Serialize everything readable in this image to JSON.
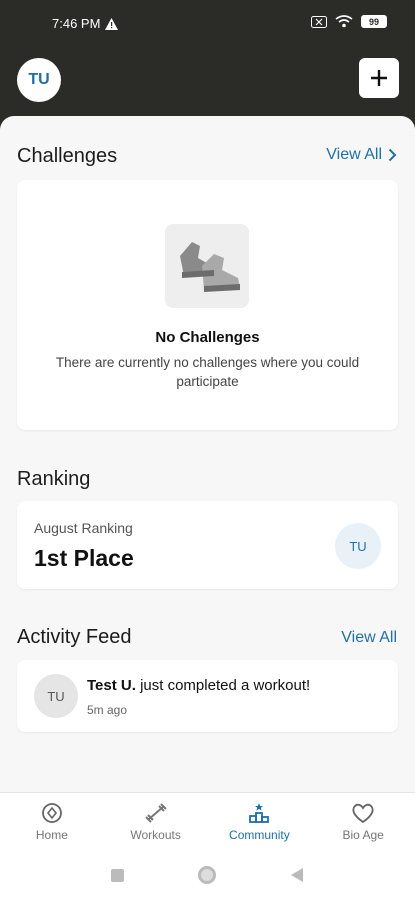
{
  "status": {
    "time": "7:46 PM",
    "battery": "99"
  },
  "header": {
    "avatar_initials": "TU"
  },
  "challenges": {
    "title": "Challenges",
    "view_all": "View All",
    "empty_title": "No Challenges",
    "empty_desc": "There are currently no challenges where you could participate"
  },
  "ranking": {
    "title": "Ranking",
    "label": "August Ranking",
    "value": "1st Place",
    "avatar_initials": "TU"
  },
  "feed": {
    "title": "Activity Feed",
    "view_all": "View All",
    "items": [
      {
        "avatar_initials": "TU",
        "user": "Test U.",
        "action": " just completed a workout!",
        "time": "5m ago"
      }
    ]
  },
  "nav": {
    "items": [
      {
        "label": "Home",
        "icon": "home-target-icon"
      },
      {
        "label": "Workouts",
        "icon": "dumbbell-icon"
      },
      {
        "label": "Community",
        "icon": "community-podium-icon",
        "active": true
      },
      {
        "label": "Bio Age",
        "icon": "heart-icon"
      }
    ]
  },
  "colors": {
    "accent": "#1f6fa8",
    "header_bg": "#2b2c28",
    "sheet_bg": "#f7f7f7"
  }
}
